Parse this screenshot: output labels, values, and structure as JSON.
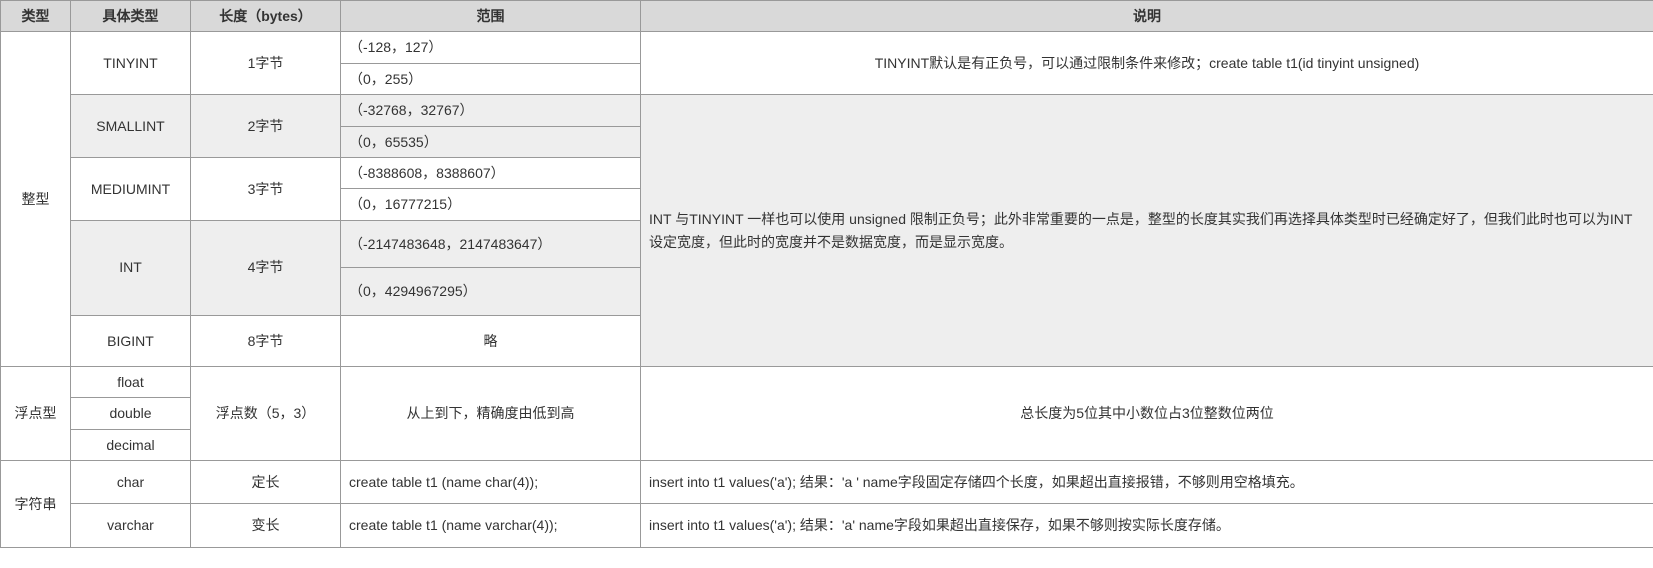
{
  "headers": {
    "c1": "类型",
    "c2": "具体类型",
    "c3": "长度（bytes）",
    "c4": "范围",
    "c5": "说明"
  },
  "cat": {
    "int": "整型",
    "float": "浮点型",
    "string": "字符串"
  },
  "int": {
    "tinyint": {
      "name": "TINYINT",
      "len": "1字节",
      "r1": "（-128，127）",
      "r2": "（0，255）",
      "desc": "TINYINT默认是有正负号，可以通过限制条件来修改；create table t1(id tinyint unsigned)"
    },
    "smallint": {
      "name": "SMALLINT",
      "len": "2字节",
      "r1": "（-32768，32767）",
      "r2": "（0，65535）"
    },
    "mediumint": {
      "name": "MEDIUMINT",
      "len": "3字节",
      "r1": "（-8388608，8388607）",
      "r2": "（0，16777215）"
    },
    "intt": {
      "name": "INT",
      "len": "4字节",
      "r1": "（-2147483648，2147483647）",
      "r2": "（0，4294967295）",
      "desc": "INT 与TINYINT 一样也可以使用 unsigned 限制正负号；此外非常重要的一点是，整型的长度其实我们再选择具体类型时已经确定好了，但我们此时也可以为INT设定宽度，但此时的宽度并不是数据宽度，而是显示宽度。"
    },
    "bigint": {
      "name": "BIGINT",
      "len": "8字节",
      "r1": "略"
    }
  },
  "float": {
    "float": "float",
    "double": "double",
    "decimal": "decimal",
    "len": "浮点数（5，3）",
    "range": "从上到下，精确度由低到高",
    "desc": "总长度为5位其中小数位占3位整数位两位"
  },
  "string": {
    "char": {
      "name": "char",
      "len": "定长",
      "range": "create table t1 (name char(4));",
      "desc": "insert into t1 values('a'); 结果：'a   ' name字段固定存储四个长度，如果超出直接报错，不够则用空格填充。"
    },
    "varchar": {
      "name": "varchar",
      "len": "变长",
      "range": "create table t1 (name varchar(4));",
      "desc": "insert into t1 values('a'); 结果：'a' name字段如果超出直接保存，如果不够则按实际长度存储。"
    }
  }
}
